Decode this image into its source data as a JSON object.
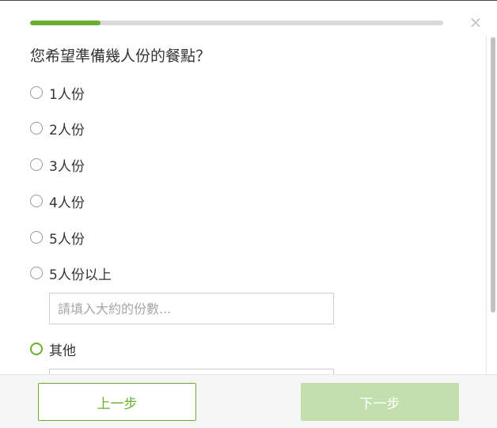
{
  "survey": {
    "progress_percent": 17,
    "close_icon": "close-icon",
    "question": "您希望準備幾人份的餐點？",
    "options": [
      {
        "label": "1人份",
        "selected": false
      },
      {
        "label": "2人份",
        "selected": false
      },
      {
        "label": "3人份",
        "selected": false
      },
      {
        "label": "4人份",
        "selected": false
      },
      {
        "label": "5人份",
        "selected": false
      },
      {
        "label": "5人份以上",
        "selected": false
      },
      {
        "label": "其他",
        "selected": true
      }
    ],
    "more_than_five_input": {
      "placeholder": "請填入大約的份數...",
      "value": ""
    },
    "other_input": {
      "placeholder": "",
      "value": ""
    }
  },
  "footer": {
    "prev_label": "上一步",
    "next_label": "下一步"
  },
  "colors": {
    "accent": "#6aae2f",
    "accent_disabled": "#c4dfae",
    "track": "#d9d9d9"
  }
}
